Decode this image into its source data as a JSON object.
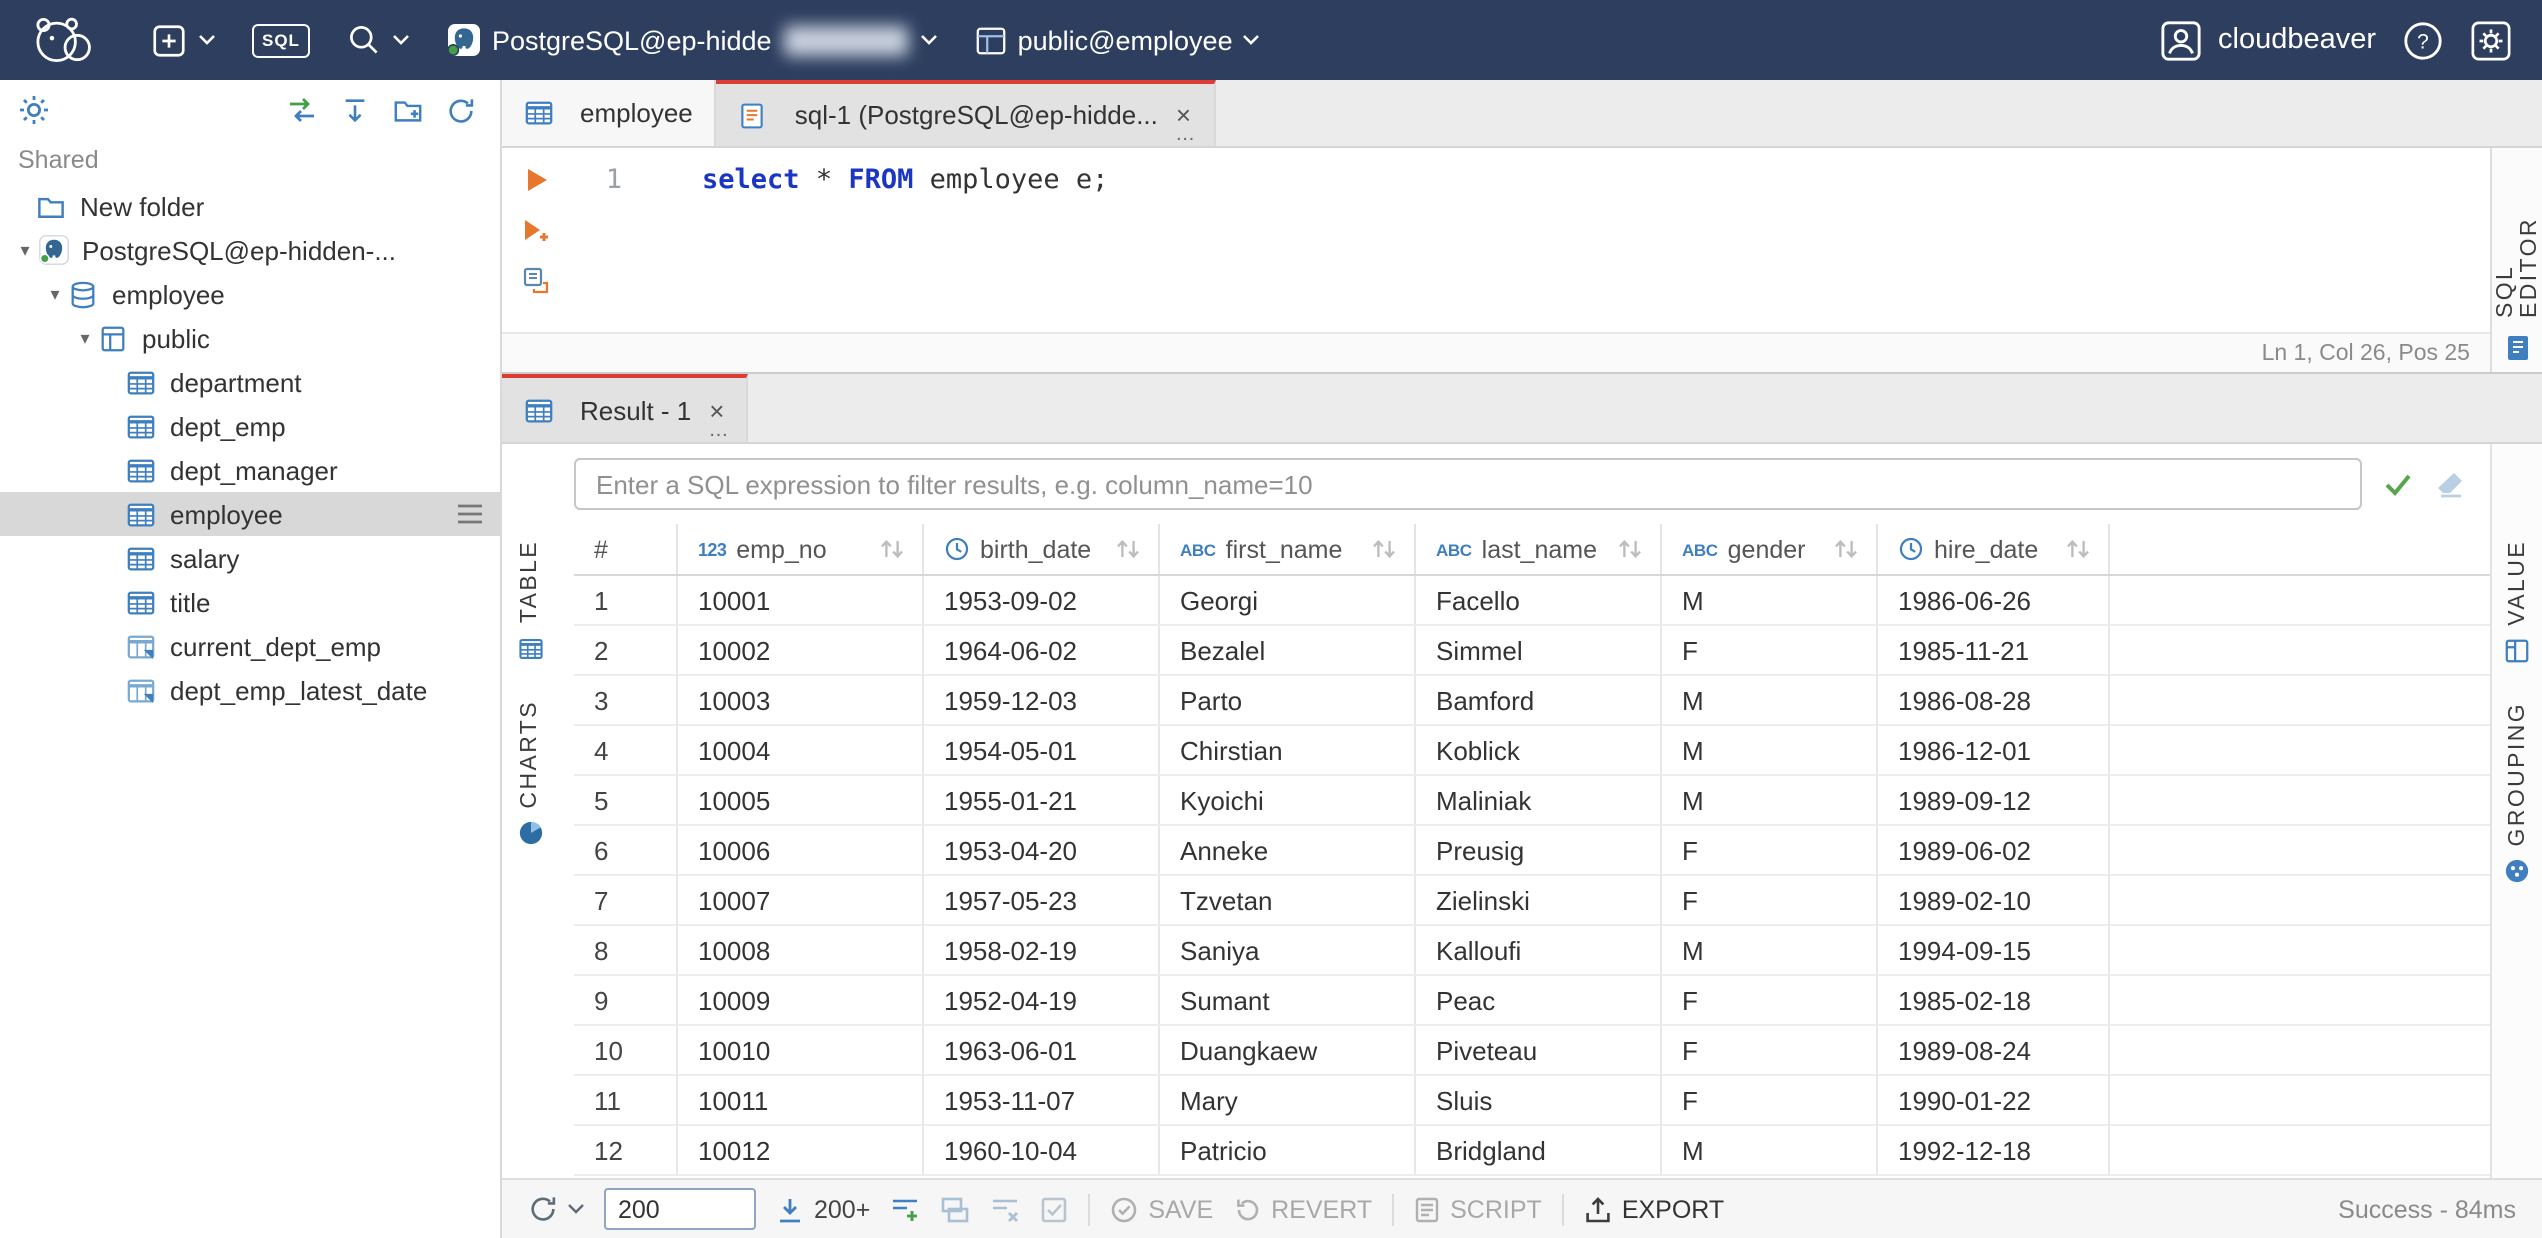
{
  "ui": {
    "close_glyph": "×",
    "dots_glyph": "…",
    "tree_chevron": "▾"
  },
  "topbar": {
    "sql_button_label": "SQL",
    "connection_label": "PostgreSQL@ep-hidde",
    "schema_label": "public@employee",
    "user_label": "cloudbeaver"
  },
  "sidebar": {
    "section_label": "Shared",
    "items": [
      {
        "label": "New folder",
        "icon": "folder",
        "level": 0,
        "expandable": false
      },
      {
        "label": "PostgreSQL@ep-hidden-...",
        "icon": "postgres",
        "level": 0,
        "expandable": true
      },
      {
        "label": "employee",
        "icon": "database",
        "level": 1,
        "expandable": true
      },
      {
        "label": "public",
        "icon": "schema",
        "level": 2,
        "expandable": true
      },
      {
        "label": "department",
        "icon": "table",
        "level": 3
      },
      {
        "label": "dept_emp",
        "icon": "table",
        "level": 3
      },
      {
        "label": "dept_manager",
        "icon": "table",
        "level": 3
      },
      {
        "label": "employee",
        "icon": "table",
        "level": 3,
        "selected": true
      },
      {
        "label": "salary",
        "icon": "table",
        "level": 3
      },
      {
        "label": "title",
        "icon": "table",
        "level": 3
      },
      {
        "label": "current_dept_emp",
        "icon": "view",
        "level": 3
      },
      {
        "label": "dept_emp_latest_date",
        "icon": "view",
        "level": 3
      }
    ]
  },
  "tabs": [
    {
      "label": "employee"
    },
    {
      "label": "sql-1 (PostgreSQL@ep-hidde..."
    }
  ],
  "sql_editor": {
    "line_number": "1",
    "tokens": [
      {
        "text": "select",
        "type": "keyword"
      },
      {
        "text": " * ",
        "type": "plain"
      },
      {
        "text": "FROM",
        "type": "keyword"
      },
      {
        "text": " employee e;",
        "type": "plain"
      }
    ],
    "status": "Ln 1, Col 26, Pos 25",
    "panel_label": "SQL EDITOR"
  },
  "result": {
    "tab_label": "Result - 1",
    "filter_placeholder": "Enter a SQL expression to filter results, e.g. column_name=10",
    "left_panel_tabs": [
      "TABLE",
      "CHARTS"
    ],
    "right_panel_tabs": [
      "VALUE",
      "GROUPING"
    ]
  },
  "grid": {
    "type_badges": {
      "number": "123",
      "string": "ABC"
    },
    "columns": [
      {
        "label": "#",
        "type": "rownum"
      },
      {
        "label": "emp_no",
        "type": "number"
      },
      {
        "label": "birth_date",
        "type": "datetime"
      },
      {
        "label": "first_name",
        "type": "string"
      },
      {
        "label": "last_name",
        "type": "string"
      },
      {
        "label": "gender",
        "type": "string"
      },
      {
        "label": "hire_date",
        "type": "datetime"
      }
    ],
    "rows": [
      [
        "1",
        "10001",
        "1953-09-02",
        "Georgi",
        "Facello",
        "M",
        "1986-06-26"
      ],
      [
        "2",
        "10002",
        "1964-06-02",
        "Bezalel",
        "Simmel",
        "F",
        "1985-11-21"
      ],
      [
        "3",
        "10003",
        "1959-12-03",
        "Parto",
        "Bamford",
        "M",
        "1986-08-28"
      ],
      [
        "4",
        "10004",
        "1954-05-01",
        "Chirstian",
        "Koblick",
        "M",
        "1986-12-01"
      ],
      [
        "5",
        "10005",
        "1955-01-21",
        "Kyoichi",
        "Maliniak",
        "M",
        "1989-09-12"
      ],
      [
        "6",
        "10006",
        "1953-04-20",
        "Anneke",
        "Preusig",
        "F",
        "1989-06-02"
      ],
      [
        "7",
        "10007",
        "1957-05-23",
        "Tzvetan",
        "Zielinski",
        "F",
        "1989-02-10"
      ],
      [
        "8",
        "10008",
        "1958-02-19",
        "Saniya",
        "Kalloufi",
        "M",
        "1994-09-15"
      ],
      [
        "9",
        "10009",
        "1952-04-19",
        "Sumant",
        "Peac",
        "F",
        "1985-02-18"
      ],
      [
        "10",
        "10010",
        "1963-06-01",
        "Duangkaew",
        "Piveteau",
        "F",
        "1989-08-24"
      ],
      [
        "11",
        "10011",
        "1953-11-07",
        "Mary",
        "Sluis",
        "F",
        "1990-01-22"
      ],
      [
        "12",
        "10012",
        "1960-10-04",
        "Patricio",
        "Bridgland",
        "M",
        "1992-12-18"
      ]
    ]
  },
  "toolbar": {
    "fetch_size_value": "200",
    "fetch_page_label": "200+",
    "save_label": "SAVE",
    "revert_label": "REVERT",
    "script_label": "SCRIPT",
    "export_label": "EXPORT",
    "status_label": "Success - 84ms"
  }
}
